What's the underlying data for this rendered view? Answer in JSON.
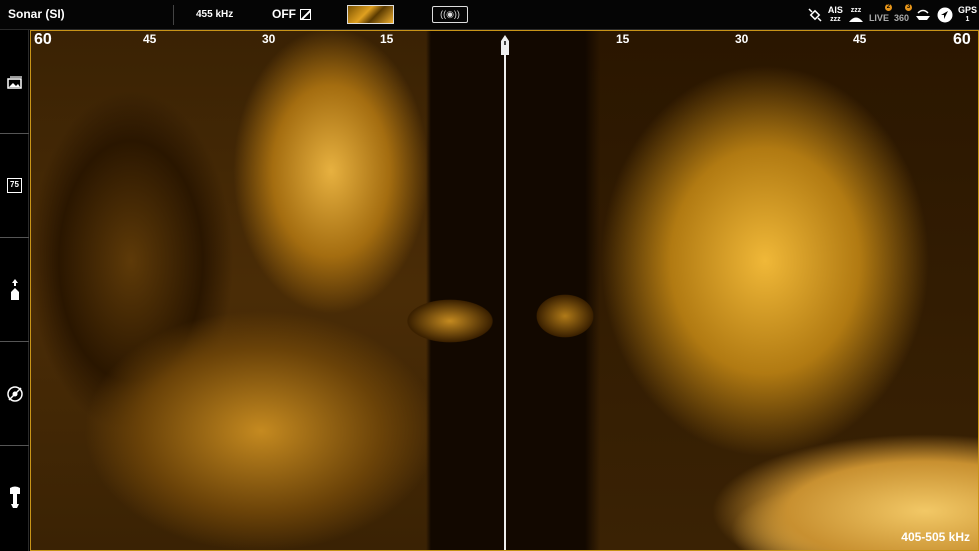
{
  "header": {
    "title": "Sonar (SI)",
    "frequency": "455 kHz",
    "off_label": "OFF",
    "xdcr_label": "((◉))"
  },
  "status_icons": {
    "ais": "AIS",
    "ais_sub": "zzz",
    "sleep": "zzz",
    "live": "LIVE",
    "live_badge": "2",
    "three60": "360",
    "three60_badge": "3",
    "gps": "GPS",
    "gps_sub": "1"
  },
  "sidebar": {
    "items": [
      {
        "icon": "image-stack-icon"
      },
      {
        "icon": "temperature-icon",
        "label": "75"
      },
      {
        "icon": "boat-up-icon"
      },
      {
        "icon": "rotation-icon"
      },
      {
        "icon": "motor-icon"
      }
    ]
  },
  "scale": {
    "left": [
      "60",
      "45",
      "30",
      "15"
    ],
    "right": [
      "15",
      "30",
      "45",
      "60"
    ]
  },
  "footer": {
    "frequency_range": "405-505 kHz"
  },
  "colors": {
    "accent": "#c89418",
    "sonar_bright": "#f0b838",
    "sonar_dark": "#120800"
  }
}
